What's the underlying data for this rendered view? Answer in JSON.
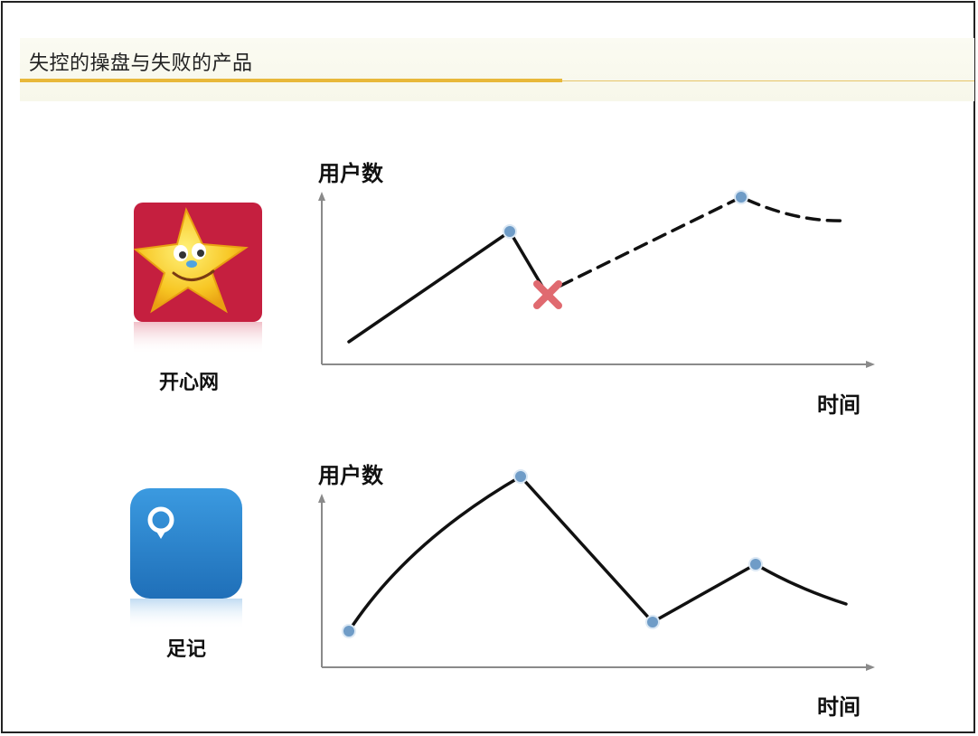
{
  "slide": {
    "title": "失控的操盘与失败的产品"
  },
  "panels": [
    {
      "app_name": "开心网",
      "icon": "kaixin-star-icon",
      "y_label": "用户数",
      "x_label": "时间"
    },
    {
      "app_name": "足记",
      "icon": "zuji-location-icon",
      "y_label": "用户数",
      "x_label": "时间"
    }
  ],
  "colors": {
    "accent": "#e8b83a",
    "kaixin_bg": "#c51f3f",
    "zuji_bg": "#2a86cf",
    "point": "#6f9cc7",
    "failure_mark": "#e06a70"
  }
}
